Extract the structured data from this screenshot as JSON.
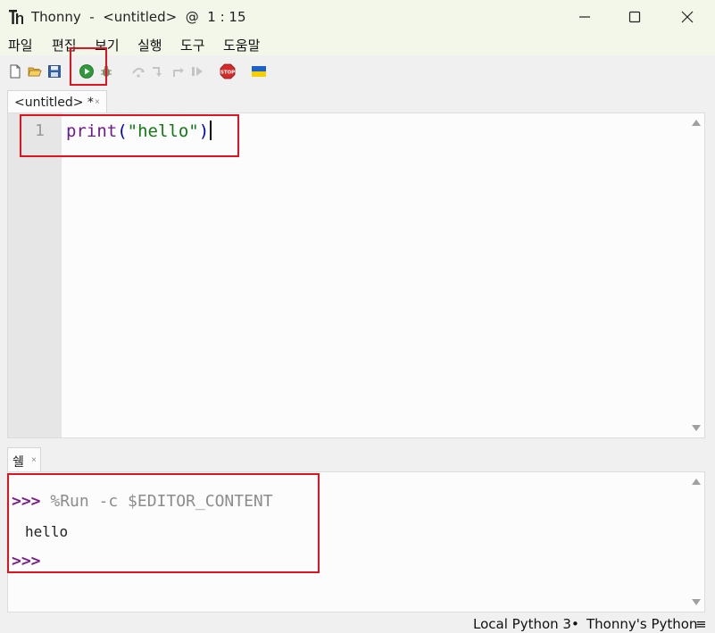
{
  "window": {
    "title": "Thonny  -  <untitled>  @  1 : 15",
    "controls": [
      "minimize-icon",
      "maximize-icon",
      "close-icon"
    ]
  },
  "menu": {
    "items": [
      "파일",
      "편집",
      "보기",
      "실행",
      "도구",
      "도움말"
    ]
  },
  "toolbar": {
    "icons": [
      "new-file-icon",
      "open-folder-icon",
      "save-icon",
      "run-icon",
      "debug-icon",
      "step-over-icon",
      "step-into-icon",
      "step-out-icon",
      "resume-icon",
      "stop-icon",
      "ukraine-flag-icon"
    ],
    "stop_label": "STOP"
  },
  "editor": {
    "tab_label": "<untitled> *",
    "tab_close": "×",
    "line_number": "1",
    "code": {
      "builtin": "print",
      "open_paren": "(",
      "string": "\"hello\"",
      "close_paren": ")"
    }
  },
  "shell": {
    "tab_label": "쉘",
    "tab_close": "×",
    "lines": {
      "prompt1": ">>>",
      "command": " %Run -c $EDITOR_CONTENT",
      "output": "hello",
      "prompt2": ">>>"
    }
  },
  "status": {
    "interpreter": "Local Python 3",
    "separator": "•",
    "variant": "Thonny's Python",
    "menu": "≡"
  },
  "colors": {
    "annotation": "#e0141e",
    "prompt": "#7a1d8c",
    "string": "#127a12",
    "builtin": "#6d1a90"
  }
}
